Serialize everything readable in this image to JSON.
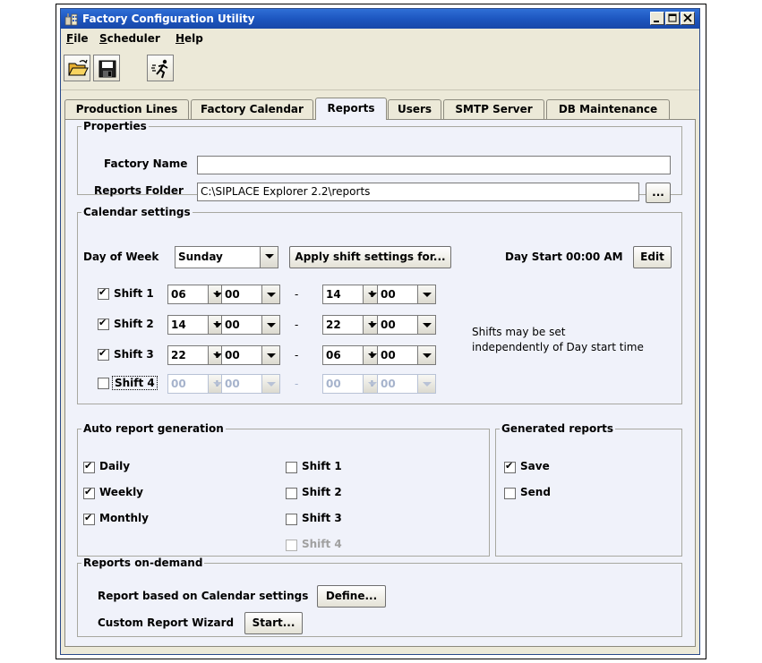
{
  "window": {
    "title": "Factory Configuration Utility"
  },
  "menubar": {
    "items": [
      {
        "key": "F",
        "rest": "ile"
      },
      {
        "key": "S",
        "rest": "cheduler"
      },
      {
        "key": "H",
        "rest": "elp"
      }
    ]
  },
  "tabs": [
    "Production Lines",
    "Factory Calendar",
    "Reports",
    "Users",
    "SMTP Server",
    "DB Maintenance"
  ],
  "active_tab": "Reports",
  "properties": {
    "legend": "Properties",
    "factory_name_label": "Factory Name",
    "factory_name_value": "",
    "reports_folder_label": "Reports Folder",
    "reports_folder_value": "C:\\SIPLACE Explorer 2.2\\reports",
    "browse_label": "..."
  },
  "calendar": {
    "legend": "Calendar settings",
    "day_of_week_label": "Day of Week",
    "day_of_week_value": "Sunday",
    "apply_button": "Apply shift settings for...",
    "day_start_label": "Day Start 00:00 AM",
    "edit_button": "Edit",
    "colon": ":",
    "dash": "-",
    "shifts": [
      {
        "label": "Shift 1",
        "checked": true,
        "start_h": "06",
        "start_m": "00",
        "end_h": "14",
        "end_m": "00",
        "enabled": true
      },
      {
        "label": "Shift 2",
        "checked": true,
        "start_h": "14",
        "start_m": "00",
        "end_h": "22",
        "end_m": "00",
        "enabled": true
      },
      {
        "label": "Shift 3",
        "checked": true,
        "start_h": "22",
        "start_m": "00",
        "end_h": "06",
        "end_m": "00",
        "enabled": true
      },
      {
        "label": "Shift 4",
        "checked": false,
        "start_h": "00",
        "start_m": "00",
        "end_h": "00",
        "end_m": "00",
        "enabled": false
      }
    ],
    "note_line1": "Shifts may be set",
    "note_line2": "independently of Day start time"
  },
  "auto_report": {
    "legend": "Auto report generation",
    "left": [
      {
        "label": "Daily",
        "checked": true
      },
      {
        "label": "Weekly",
        "checked": true
      },
      {
        "label": "Monthly",
        "checked": true
      }
    ],
    "right": [
      {
        "label": "Shift 1",
        "checked": false,
        "enabled": true
      },
      {
        "label": "Shift 2",
        "checked": false,
        "enabled": true
      },
      {
        "label": "Shift 3",
        "checked": false,
        "enabled": true
      },
      {
        "label": "Shift 4",
        "checked": false,
        "enabled": false
      }
    ]
  },
  "generated": {
    "legend": "Generated reports",
    "items": [
      {
        "label": "Save",
        "checked": true
      },
      {
        "label": "Send",
        "checked": false
      }
    ]
  },
  "ondemand": {
    "legend": "Reports on-demand",
    "calendar_label": "Report based on Calendar settings",
    "define_button": "Define...",
    "wizard_label": "Custom Report Wizard",
    "start_button": "Start..."
  },
  "colors": {
    "title_bar": "#1d56c0",
    "panel": "#f0f2fa",
    "window_bg": "#ece9d8"
  }
}
